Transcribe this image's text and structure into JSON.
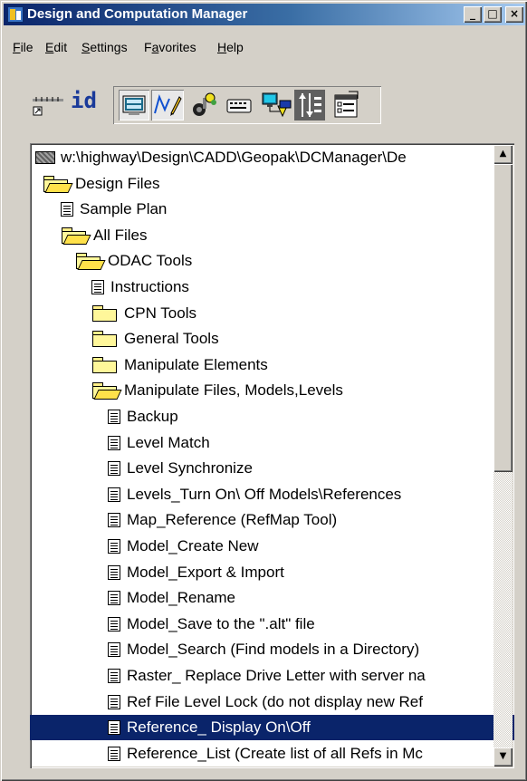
{
  "window": {
    "title": "Design and Computation Manager",
    "minimize_glyph": "_",
    "maximize_glyph": "□",
    "close_glyph": "×"
  },
  "menu": [
    {
      "label": "File",
      "key": "F",
      "rest": "ile"
    },
    {
      "label": "Edit",
      "key": "E",
      "rest": "dit"
    },
    {
      "label": "Settings",
      "key": "S",
      "rest": "ettings"
    },
    {
      "label": "Favorites",
      "pre": "F",
      "key": "a",
      "rest": "vorites"
    },
    {
      "label": "Help",
      "key": "H",
      "rest": "elp"
    }
  ],
  "toolbar": {
    "id_label": "id",
    "icons": [
      "ruler-icon",
      "id-icon",
      "grid-view-icon",
      "draw-mode-icon",
      "key-icon",
      "keyboard-icon",
      "network-icon",
      "properties-icon",
      "checklist-icon"
    ]
  },
  "tree": {
    "items": [
      {
        "type": "drive",
        "label": "w:\\highway\\Design\\CADD\\Geopak\\DCManager\\De"
      },
      {
        "type": "folder-open",
        "label": "Design Files"
      },
      {
        "type": "doc",
        "label": "Sample Plan"
      },
      {
        "type": "folder-open",
        "label": "All Files"
      },
      {
        "type": "folder-open",
        "label": "ODAC Tools"
      },
      {
        "type": "doc",
        "label": "Instructions"
      },
      {
        "type": "folder",
        "label": "CPN Tools"
      },
      {
        "type": "folder",
        "label": "General Tools"
      },
      {
        "type": "folder",
        "label": "Manipulate Elements"
      },
      {
        "type": "folder-open",
        "label": "Manipulate Files, Models,Levels"
      },
      {
        "type": "doc",
        "label": "Backup"
      },
      {
        "type": "doc",
        "label": "Level Match"
      },
      {
        "type": "doc",
        "label": "Level Synchronize"
      },
      {
        "type": "doc",
        "label": "Levels_Turn On\\ Off Models\\References"
      },
      {
        "type": "doc",
        "label": "Map_Reference (RefMap Tool)"
      },
      {
        "type": "doc",
        "label": "Model_Create New"
      },
      {
        "type": "doc",
        "label": "Model_Export & Import"
      },
      {
        "type": "doc",
        "label": "Model_Rename"
      },
      {
        "type": "doc",
        "label": "Model_Save to the \".alt\" file"
      },
      {
        "type": "doc",
        "label": "Model_Search (Find models in a Directory)"
      },
      {
        "type": "doc",
        "label": "Raster_ Replace Drive Letter with server na"
      },
      {
        "type": "doc",
        "label": "Ref File Level Lock (do not display new Ref"
      },
      {
        "type": "doc",
        "label": "Reference_ Display On\\Off",
        "selected": true
      },
      {
        "type": "doc",
        "label": "Reference_List (Create list of all Refs in Mc"
      }
    ]
  },
  "scrollbar": {
    "up_glyph": "▲",
    "down_glyph": "▼",
    "position": 0.0
  }
}
